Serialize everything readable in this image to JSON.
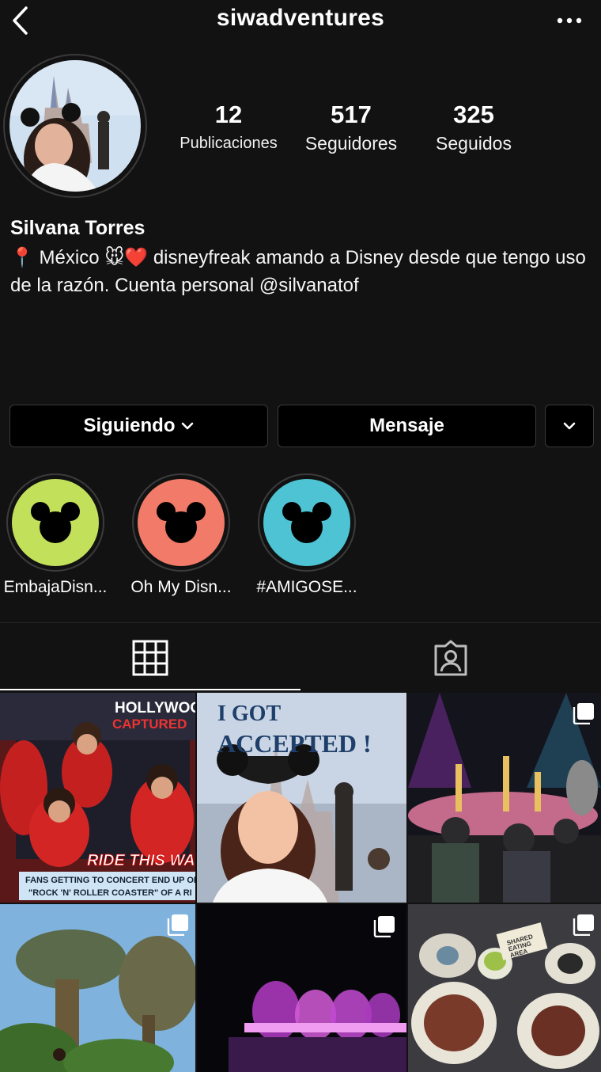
{
  "header": {
    "username": "siwadventures",
    "back_icon": "chevron-left-icon",
    "more_icon": "more-horizontal-icon"
  },
  "profile": {
    "stats": [
      {
        "value": "12",
        "label": "Publicaciones"
      },
      {
        "value": "517",
        "label": "Seguidores"
      },
      {
        "value": "325",
        "label": "Seguidos"
      }
    ],
    "name": "Silvana Torres",
    "bio": "📍 México 🐭❤️ disneyfreak amando a Disney desde que tengo uso de la razón. Cuenta personal @silvanatof"
  },
  "actions": {
    "following_label": "Siguiendo",
    "message_label": "Mensaje"
  },
  "highlights": [
    {
      "label": "EmbajaDisn...",
      "color": "#c3e05a"
    },
    {
      "label": "Oh My Disn...",
      "color": "#f27a68"
    },
    {
      "label": "#AMIGOSE...",
      "color": "#4dc3d3"
    }
  ],
  "tabs": [
    {
      "icon": "grid-icon",
      "active": true
    },
    {
      "icon": "tagged-person-icon",
      "active": false
    }
  ],
  "posts": [
    {
      "caption_lines": [
        "HOLLYWOOD",
        "CAPTURED",
        "RIDE THIS WAY",
        "FANS GETTING TO CONCERT END UP ON",
        "\"ROCK 'N' ROLLER COASTER\" OF A RI"
      ],
      "multi": false
    },
    {
      "caption_lines": [
        "I GOT",
        "ACCEPTED !"
      ],
      "multi": false
    },
    {
      "caption_lines": [],
      "multi": true
    },
    {
      "caption_lines": [],
      "multi": true
    },
    {
      "caption_lines": [],
      "multi": true
    },
    {
      "caption_lines": [
        "SHARED",
        "EATING",
        "AREA"
      ],
      "multi": true
    }
  ],
  "colors": {
    "background": "#121212",
    "button_bg": "#000000",
    "border": "#3a3a3a"
  }
}
